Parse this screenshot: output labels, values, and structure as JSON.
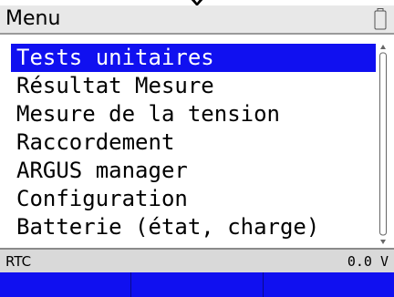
{
  "title_bar": {
    "title": "Menu",
    "battery_icon": "battery-empty-icon"
  },
  "menu": {
    "selected_index": 0,
    "items": [
      {
        "label": "Tests unitaires"
      },
      {
        "label": "Résultat Mesure"
      },
      {
        "label": "Mesure de la tension"
      },
      {
        "label": "Raccordement"
      },
      {
        "label": "ARGUS manager"
      },
      {
        "label": "Configuration"
      },
      {
        "label": "Batterie (état, charge)"
      }
    ]
  },
  "status_bar": {
    "left": "RTC",
    "right": "0.0 V"
  },
  "softkeys": [
    {
      "label": ""
    },
    {
      "label": ""
    },
    {
      "label": ""
    }
  ],
  "colors": {
    "selection": "#1010f0",
    "softkey": "#1010f0",
    "title_bg": "#e8e8e8",
    "status_bg": "#d9d9d9"
  }
}
